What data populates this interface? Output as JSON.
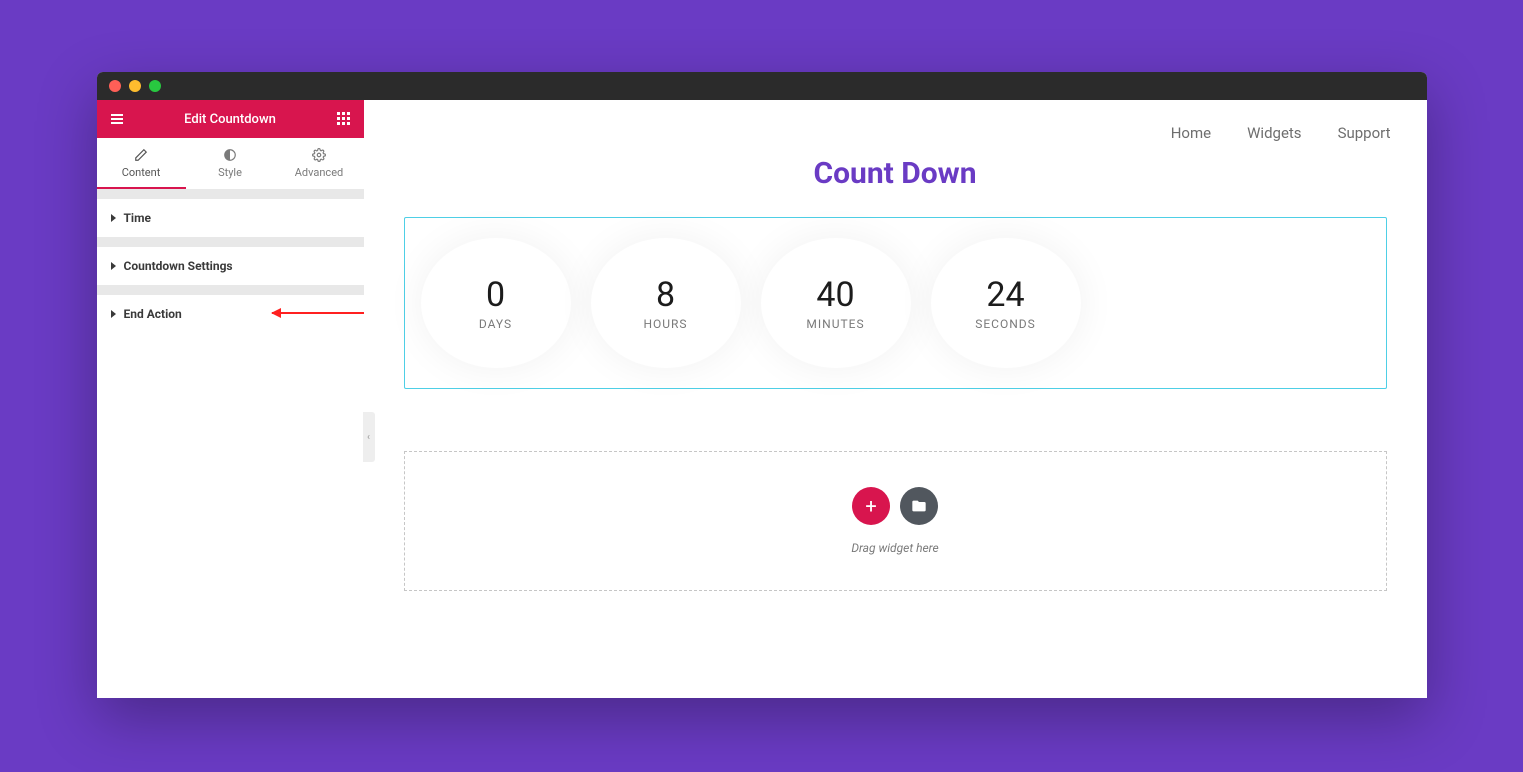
{
  "sidebar": {
    "title": "Edit Countdown",
    "tabs": [
      {
        "label": "Content",
        "active": true
      },
      {
        "label": "Style",
        "active": false
      },
      {
        "label": "Advanced",
        "active": false
      }
    ],
    "sections": [
      {
        "label": "Time"
      },
      {
        "label": "Countdown Settings"
      },
      {
        "label": "End Action"
      }
    ]
  },
  "nav": {
    "items": [
      "Home",
      "Widgets",
      "Support"
    ]
  },
  "page": {
    "title": "Count Down"
  },
  "countdown": {
    "items": [
      {
        "value": "0",
        "label": "DAYS"
      },
      {
        "value": "8",
        "label": "HOURS"
      },
      {
        "value": "40",
        "label": "MINUTES"
      },
      {
        "value": "24",
        "label": "SECONDS"
      }
    ]
  },
  "dropzone": {
    "hint": "Drag widget here"
  }
}
